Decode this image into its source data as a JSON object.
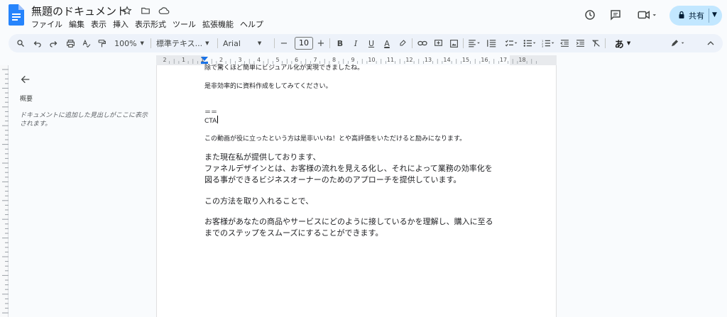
{
  "app": {
    "title": "無題のドキュメント",
    "menu": [
      "ファイル",
      "編集",
      "表示",
      "挿入",
      "表示形式",
      "ツール",
      "拡張機能",
      "ヘルプ"
    ],
    "share_label": "共有"
  },
  "toolbar": {
    "zoom": "100%",
    "style": "標準テキス...",
    "font": "Arial",
    "font_size": "10",
    "minus": "−",
    "plus": "+",
    "bold": "B",
    "italic": "I",
    "underline": "U",
    "text_color": "A",
    "input_mode": "あ"
  },
  "ruler": {
    "labels": [
      "2",
      "1",
      "1",
      "2",
      "3",
      "4",
      "5",
      "6",
      "7",
      "8",
      "9",
      "10",
      "11",
      "12",
      "13",
      "14",
      "15",
      "16",
      "17",
      "18"
    ]
  },
  "outline": {
    "title": "概要",
    "hint": "ドキュメントに追加した見出しがここに表示されます。"
  },
  "document": {
    "lines": [
      "除で驚くほど簡単にビジュアル化が実現できましたね。",
      "是非効率的に資料作成をしてみてください。",
      "＝＝",
      "CTA",
      "この動画が役に立ったという方は是非いいね！とや高評価をいただけると励みになります。",
      "また現在私が提供しております、",
      "ファネルデザインとは、お客様の流れを見える化し、それによって業務の効率化を",
      "図る事ができるビジネスオーナーのためのアプローチを提供しています。",
      "この方法を取り入れることで、",
      "お客様があなたの商品やサービスにどのように接しているかを理解し、購入に至る",
      "までのステップをスムーズにすることができます。"
    ]
  },
  "colors": {
    "accent": "#1a73e8",
    "share_bg": "#c2e7ff",
    "toolbar_bg": "#edf2fa"
  }
}
